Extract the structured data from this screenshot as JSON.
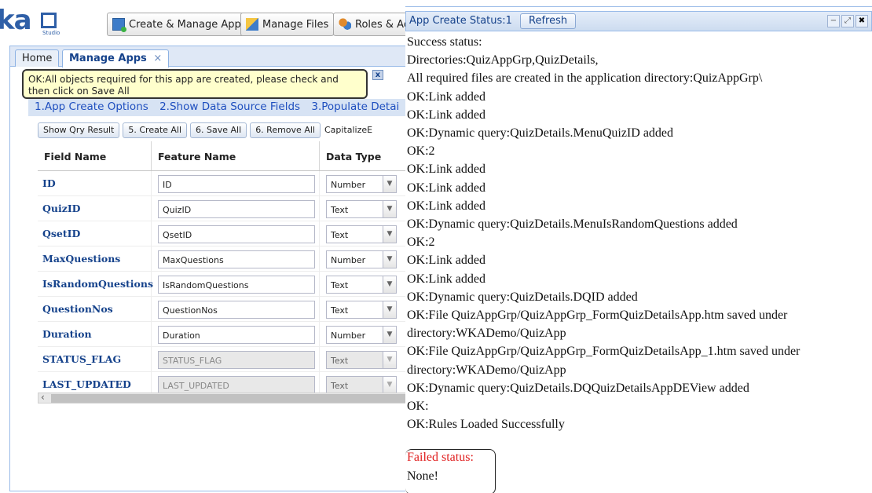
{
  "logo": {
    "text": "ka",
    "sub": "Studio"
  },
  "topnav": [
    {
      "label": "Create & Manage App"
    },
    {
      "label": "Manage Files"
    },
    {
      "label": "Roles & Ac"
    }
  ],
  "tabs": [
    {
      "label": "Home"
    },
    {
      "label": "Manage Apps",
      "close": "×"
    }
  ],
  "tooltip": {
    "text": "OK:All objects required for this app are created, please check and then click on Save All",
    "close": "x"
  },
  "steps": [
    "1.App Create Options",
    "2.Show Data Source Fields",
    "3.Populate Detai"
  ],
  "toolbar": [
    "Show Qry Result",
    "5. Create All",
    "6. Save All",
    "6. Remove All",
    "CapitalizeE"
  ],
  "grid": {
    "headers": [
      "Field Name",
      "Feature Name",
      "Data Type"
    ],
    "rows": [
      {
        "field": "ID",
        "feature": "ID",
        "type": "Number",
        "disabled": false
      },
      {
        "field": "QuizID",
        "feature": "QuizID",
        "type": "Text",
        "disabled": false
      },
      {
        "field": "QsetID",
        "feature": "QsetID",
        "type": "Text",
        "disabled": false
      },
      {
        "field": "MaxQuestions",
        "feature": "MaxQuestions",
        "type": "Number",
        "disabled": false
      },
      {
        "field": "IsRandomQuestions",
        "feature": "IsRandomQuestions",
        "type": "Text",
        "disabled": false
      },
      {
        "field": "QuestionNos",
        "feature": "QuestionNos",
        "type": "Text",
        "disabled": false
      },
      {
        "field": "Duration",
        "feature": "Duration",
        "type": "Number",
        "disabled": false
      },
      {
        "field": "STATUS_FLAG",
        "feature": "STATUS_FLAG",
        "type": "Text",
        "disabled": true
      },
      {
        "field": "LAST_UPDATED",
        "feature": "LAST_UPDATED",
        "type": "Text",
        "disabled": true
      }
    ],
    "scroll_left": "‹"
  },
  "status_window": {
    "title": "App Create Status:1",
    "refresh_label": "Refresh",
    "buttons": [
      "−",
      "⤢",
      "✖"
    ],
    "lines": [
      "Success status:",
      "Directories:QuizAppGrp,QuizDetails,",
      "All required files are created in the application directory:QuizAppGrp\\",
      "OK:Link added",
      "OK:Link added",
      "OK:Dynamic query:QuizDetails.MenuQuizID added",
      "OK:2",
      "OK:Link added",
      "OK:Link added",
      "OK:Link added",
      "OK:Dynamic query:QuizDetails.MenuIsRandomQuestions added",
      "OK:2",
      "OK:Link added",
      "OK:Link added",
      "OK:Dynamic query:QuizDetails.DQID added",
      "OK:File QuizAppGrp/QuizAppGrp_FormQuizDetailsApp.htm saved under",
      "directory:WKADemo/QuizApp",
      "OK:File QuizAppGrp/QuizAppGrp_FormQuizDetailsApp_1.htm saved under",
      "directory:WKADemo/QuizApp",
      "OK:Dynamic query:QuizDetails.DQQuizDetailsAppDEView added",
      "OK:",
      "OK:Rules Loaded Successfully"
    ],
    "failed_label": "Failed status:",
    "failed_value": "None!",
    "failed_color": "#e02020"
  }
}
